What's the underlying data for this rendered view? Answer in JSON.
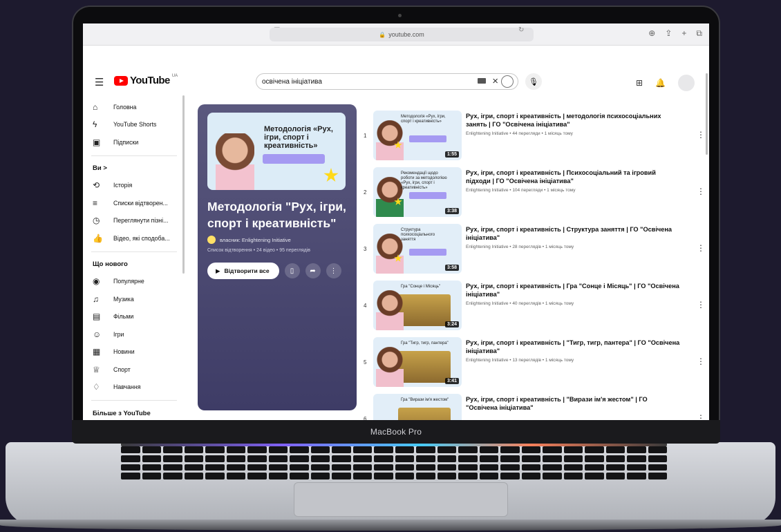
{
  "device": {
    "label": "MacBook Pro"
  },
  "browser": {
    "url": "youtube.com"
  },
  "header": {
    "logo_text": "YouTube",
    "region": "UA",
    "search_value": "освічена ініціатива",
    "icons": [
      "menu-icon",
      "create-icon",
      "bell-icon",
      "mic-icon",
      "search-icon",
      "keyboard-icon",
      "close-icon"
    ]
  },
  "sidebar": {
    "main": [
      {
        "label": "Головна",
        "icon": "home-icon"
      },
      {
        "label": "YouTube Shorts",
        "icon": "shorts-icon"
      },
      {
        "label": "Підписки",
        "icon": "subscriptions-icon"
      }
    ],
    "you_heading": "Ви  >",
    "you": [
      {
        "label": "Історія",
        "icon": "history-icon"
      },
      {
        "label": "Списки відтворен...",
        "icon": "playlists-icon"
      },
      {
        "label": "Переглянути пізні...",
        "icon": "watch-later-icon"
      },
      {
        "label": "Відео, які сподоба...",
        "icon": "liked-icon"
      }
    ],
    "explore_heading": "Що нового",
    "explore": [
      {
        "label": "Популярне",
        "icon": "trending-icon"
      },
      {
        "label": "Музика",
        "icon": "music-icon"
      },
      {
        "label": "Фільми",
        "icon": "movies-icon"
      },
      {
        "label": "Ігри",
        "icon": "gaming-icon"
      },
      {
        "label": "Новини",
        "icon": "news-icon"
      },
      {
        "label": "Спорт",
        "icon": "sport-icon"
      },
      {
        "label": "Навчання",
        "icon": "learning-icon"
      }
    ],
    "more_heading": "Більше з YouTube"
  },
  "playlist": {
    "thumb_text": "Методологія «Рух, ігри, спорт і креативність»",
    "title": "Методологія \"Рух, ігри, спорт і креативність\"",
    "owner": "власник: Enlightening Initiative",
    "meta": "Список відтворення • 24 відео • 95 переглядів",
    "play_all": "Відтворити все"
  },
  "videos": [
    {
      "num": "1",
      "title": "Рух, ігри, спорт і креативність | методологія психосоціальних занять | ГО \"Освічена ініціатива\"",
      "meta": "Enlightening Initiative • 44 перегляди • 1 місяць тому",
      "duration": "1:55",
      "thumb_text": "Методологія «Рух, ігри, спорт і креативність»"
    },
    {
      "num": "2",
      "title": "Рух, ігри, спорт і креативність | Психосоціальний та ігровий підходи | ГО \"Освічена ініціатива\"",
      "meta": "Enlightening Initiative • 104 перегляди • 1 місяць тому",
      "duration": "3:38",
      "thumb_text": "Рекомендації щодо роботи за методологією «Рух, ігри, спорт і креативність»"
    },
    {
      "num": "3",
      "title": "Рух, ігри, спорт і креативність | Структура заняття | ГО \"Освічена ініціатива\"",
      "meta": "Enlightening Initiative • 28 переглядів • 1 місяць тому",
      "duration": "3:58",
      "thumb_text": "Структура психосоціального заняття"
    },
    {
      "num": "4",
      "title": "Рух, ігри, спорт і креативність | Гра \"Сонце і Місяць\" | ГО \"Освічена ініціатива\"",
      "meta": "Enlightening Initiative • 40 переглядів • 1 місяць тому",
      "duration": "3:24",
      "thumb_text": "Гра \"Сонце і Місяць\""
    },
    {
      "num": "5",
      "title": "Рух, ігри, спорт і креативність | \"Тигр, тигр, пантера\" | ГО \"Освічена ініціатива\"",
      "meta": "Enlightening Initiative • 13 переглядів • 1 місяць тому",
      "duration": "3:41",
      "thumb_text": "Гра \"Тигр, тигр, пантера\""
    },
    {
      "num": "6",
      "title": "Рух, ігри, спорт і креативність | \"Вирази ім'я жестом\" | ГО \"Освічена ініціатива\"",
      "meta": "",
      "duration": "",
      "thumb_text": "Гра \"Вирази ім'я жестом\""
    }
  ]
}
